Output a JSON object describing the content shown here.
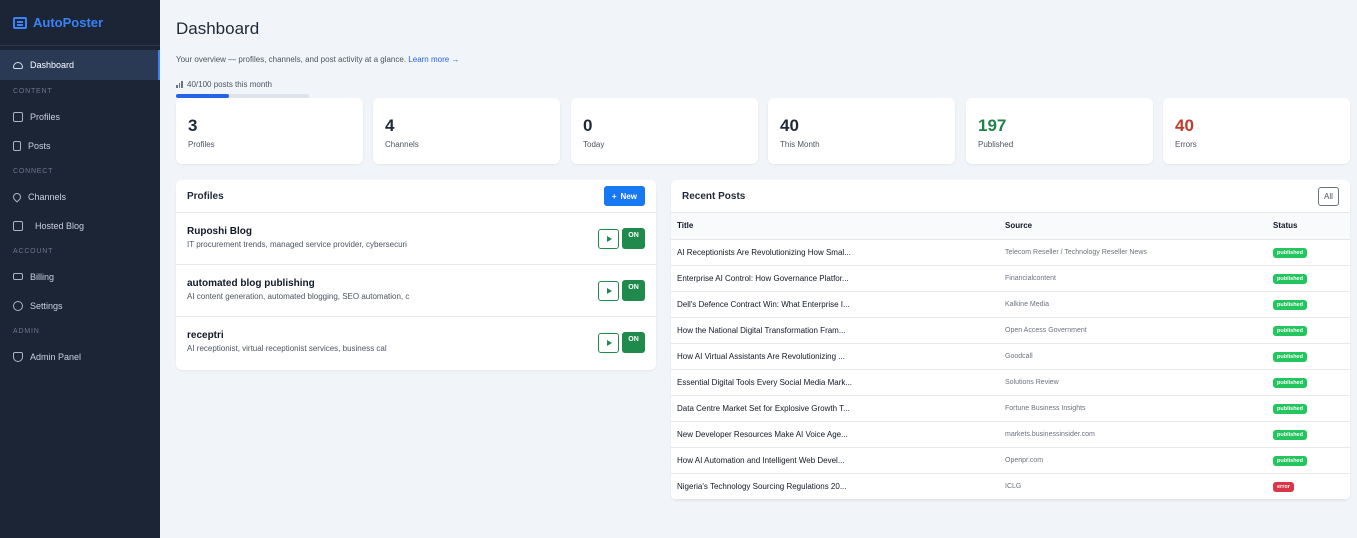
{
  "app": {
    "name": "AutoPoster"
  },
  "sidebar": {
    "dashboard": "Dashboard",
    "sections": [
      "CONTENT",
      "CONNECT",
      "ACCOUNT",
      "ADMIN"
    ],
    "items": {
      "profiles": "Profiles",
      "posts": "Posts",
      "channels": "Channels",
      "hosted_blog": "Hosted Blog",
      "billing": "Billing",
      "settings": "Settings",
      "admin_panel": "Admin Panel"
    }
  },
  "header": {
    "title": "Dashboard",
    "overview": "Your overview — profiles, channels, and post activity at a glance.",
    "learn_more": "Learn more →",
    "usage_text": "40/100 posts this month",
    "usage_fraction": 0.4
  },
  "stats": [
    {
      "value": "3",
      "label": "Profiles",
      "color": "#1f2937"
    },
    {
      "value": "4",
      "label": "Channels",
      "color": "#1f2937"
    },
    {
      "value": "0",
      "label": "Today",
      "color": "#1f2937"
    },
    {
      "value": "40",
      "label": "This Month",
      "color": "#1f2937"
    },
    {
      "value": "197",
      "label": "Published",
      "color": "#1e8449"
    },
    {
      "value": "40",
      "label": "Errors",
      "color": "#c0392b"
    }
  ],
  "profiles_card": {
    "title": "Profiles",
    "new_button": "New",
    "toggle_label": "ON",
    "items": [
      {
        "name": "Ruposhi Blog",
        "desc": "IT procurement trends, managed service provider, cybersecuri"
      },
      {
        "name": "automated blog publishing",
        "desc": "AI content generation, automated blogging, SEO automation, c"
      },
      {
        "name": "receptri",
        "desc": "AI receptionist, virtual receptionist services, business cal"
      }
    ]
  },
  "posts_card": {
    "title": "Recent Posts",
    "all_button": "All",
    "columns": {
      "title": "Title",
      "source": "Source",
      "status": "Status"
    },
    "rows": [
      {
        "title": "AI Receptionists Are Revolutionizing How Smal...",
        "source": "Telecom Reseller / Technology Reseller News",
        "status": "published"
      },
      {
        "title": "Enterprise AI Control: How Governance Platfor...",
        "source": "Financialcontent",
        "status": "published"
      },
      {
        "title": "Dell's Defence Contract Win: What Enterprise I...",
        "source": "Kalkine Media",
        "status": "published"
      },
      {
        "title": "How the National Digital Transformation Fram...",
        "source": "Open Access Government",
        "status": "published"
      },
      {
        "title": "How AI Virtual Assistants Are Revolutionizing ...",
        "source": "Goodcall",
        "status": "published"
      },
      {
        "title": "Essential Digital Tools Every Social Media Mark...",
        "source": "Solutions Review",
        "status": "published"
      },
      {
        "title": "Data Centre Market Set for Explosive Growth T...",
        "source": "Fortune Business Insights",
        "status": "published"
      },
      {
        "title": "New Developer Resources Make AI Voice Age...",
        "source": "markets.businessinsider.com",
        "status": "published"
      },
      {
        "title": "How AI Automation and Intelligent Web Devel...",
        "source": "Openpr.com",
        "status": "published"
      },
      {
        "title": "Nigeria's Technology Sourcing Regulations 20...",
        "source": "ICLG",
        "status": "error"
      }
    ]
  }
}
